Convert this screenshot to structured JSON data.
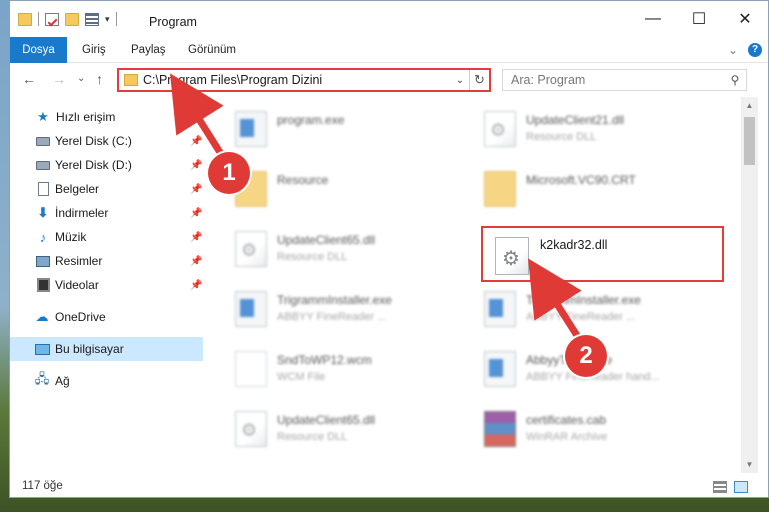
{
  "window": {
    "title": "Program",
    "controls": {
      "minimize": "—",
      "maximize": "☐",
      "close": "✕"
    }
  },
  "ribbon": {
    "tabs": [
      "Dosya",
      "Giriş",
      "Paylaş",
      "Görünüm"
    ],
    "expand": "⌄",
    "help": "?"
  },
  "address": {
    "path": "C:\\Program Files\\Program Dizini",
    "dropdown": "⌄",
    "refresh": "↻"
  },
  "search": {
    "placeholder": "Ara: Program",
    "icon": "search-icon"
  },
  "nav": {
    "back": "←",
    "forward": "→",
    "recent": "⌄",
    "up": "↑"
  },
  "sidebar": {
    "quick_access": "Hızlı erişim",
    "items": [
      {
        "label": "Yerel Disk (C:)",
        "icon": "drive-icon",
        "pinned": true
      },
      {
        "label": "Yerel Disk (D:)",
        "icon": "drive-icon",
        "pinned": true
      },
      {
        "label": "Belgeler",
        "icon": "documents-icon",
        "pinned": true
      },
      {
        "label": "İndirmeler",
        "icon": "downloads-icon",
        "pinned": true
      },
      {
        "label": "Müzik",
        "icon": "music-icon",
        "pinned": true
      },
      {
        "label": "Resimler",
        "icon": "pictures-icon",
        "pinned": true
      },
      {
        "label": "Videolar",
        "icon": "videos-icon",
        "pinned": true
      }
    ],
    "onedrive": "OneDrive",
    "this_pc": "Bu bilgisayar",
    "network": "Ağ"
  },
  "files": [
    {
      "name": "program.exe",
      "type": "",
      "icon": "exe-icon",
      "blurred": true
    },
    {
      "name": "UpdateClient21.dll",
      "type": "Resource DLL",
      "icon": "dll-icon",
      "blurred": true
    },
    {
      "name": "Resource",
      "type": "",
      "icon": "folder-icon",
      "blurred": true
    },
    {
      "name": "Microsoft.VC90.CRT",
      "type": "",
      "icon": "folder-icon",
      "blurred": true
    },
    {
      "name": "UpdateClient65.dll",
      "type": "Resource DLL",
      "icon": "dll-icon",
      "blurred": true
    },
    {
      "name": "k2kadr32.dll",
      "type": "",
      "icon": "dll-icon",
      "blurred": false
    },
    {
      "name": "TrigrammInstaller.exe",
      "type": "ABBYY FineReader ...",
      "icon": "exe-icon",
      "blurred": true
    },
    {
      "name": "TrigrammInstaller.exe",
      "type": "ABBYY FineReader ...",
      "icon": "exe-icon",
      "blurred": true
    },
    {
      "name": "SndToWP12.wcm",
      "type": "WCM File",
      "icon": "document-icon",
      "blurred": true
    },
    {
      "name": "AbbyyTrace.exe",
      "type": "ABBYY FineReader hand...",
      "icon": "exe-icon",
      "blurred": true
    },
    {
      "name": "UpdateClient65.dll",
      "type": "Resource DLL",
      "icon": "dll-icon",
      "blurred": true
    },
    {
      "name": "certificates.cab",
      "type": "WinRAR Archive",
      "icon": "archive-icon",
      "blurred": true
    }
  ],
  "status": {
    "count": "117 öğe"
  },
  "callouts": {
    "one": "1",
    "two": "2"
  },
  "colors": {
    "accent": "#1979ca",
    "highlight": "#e23c3c",
    "selected": "#cce8ff"
  }
}
